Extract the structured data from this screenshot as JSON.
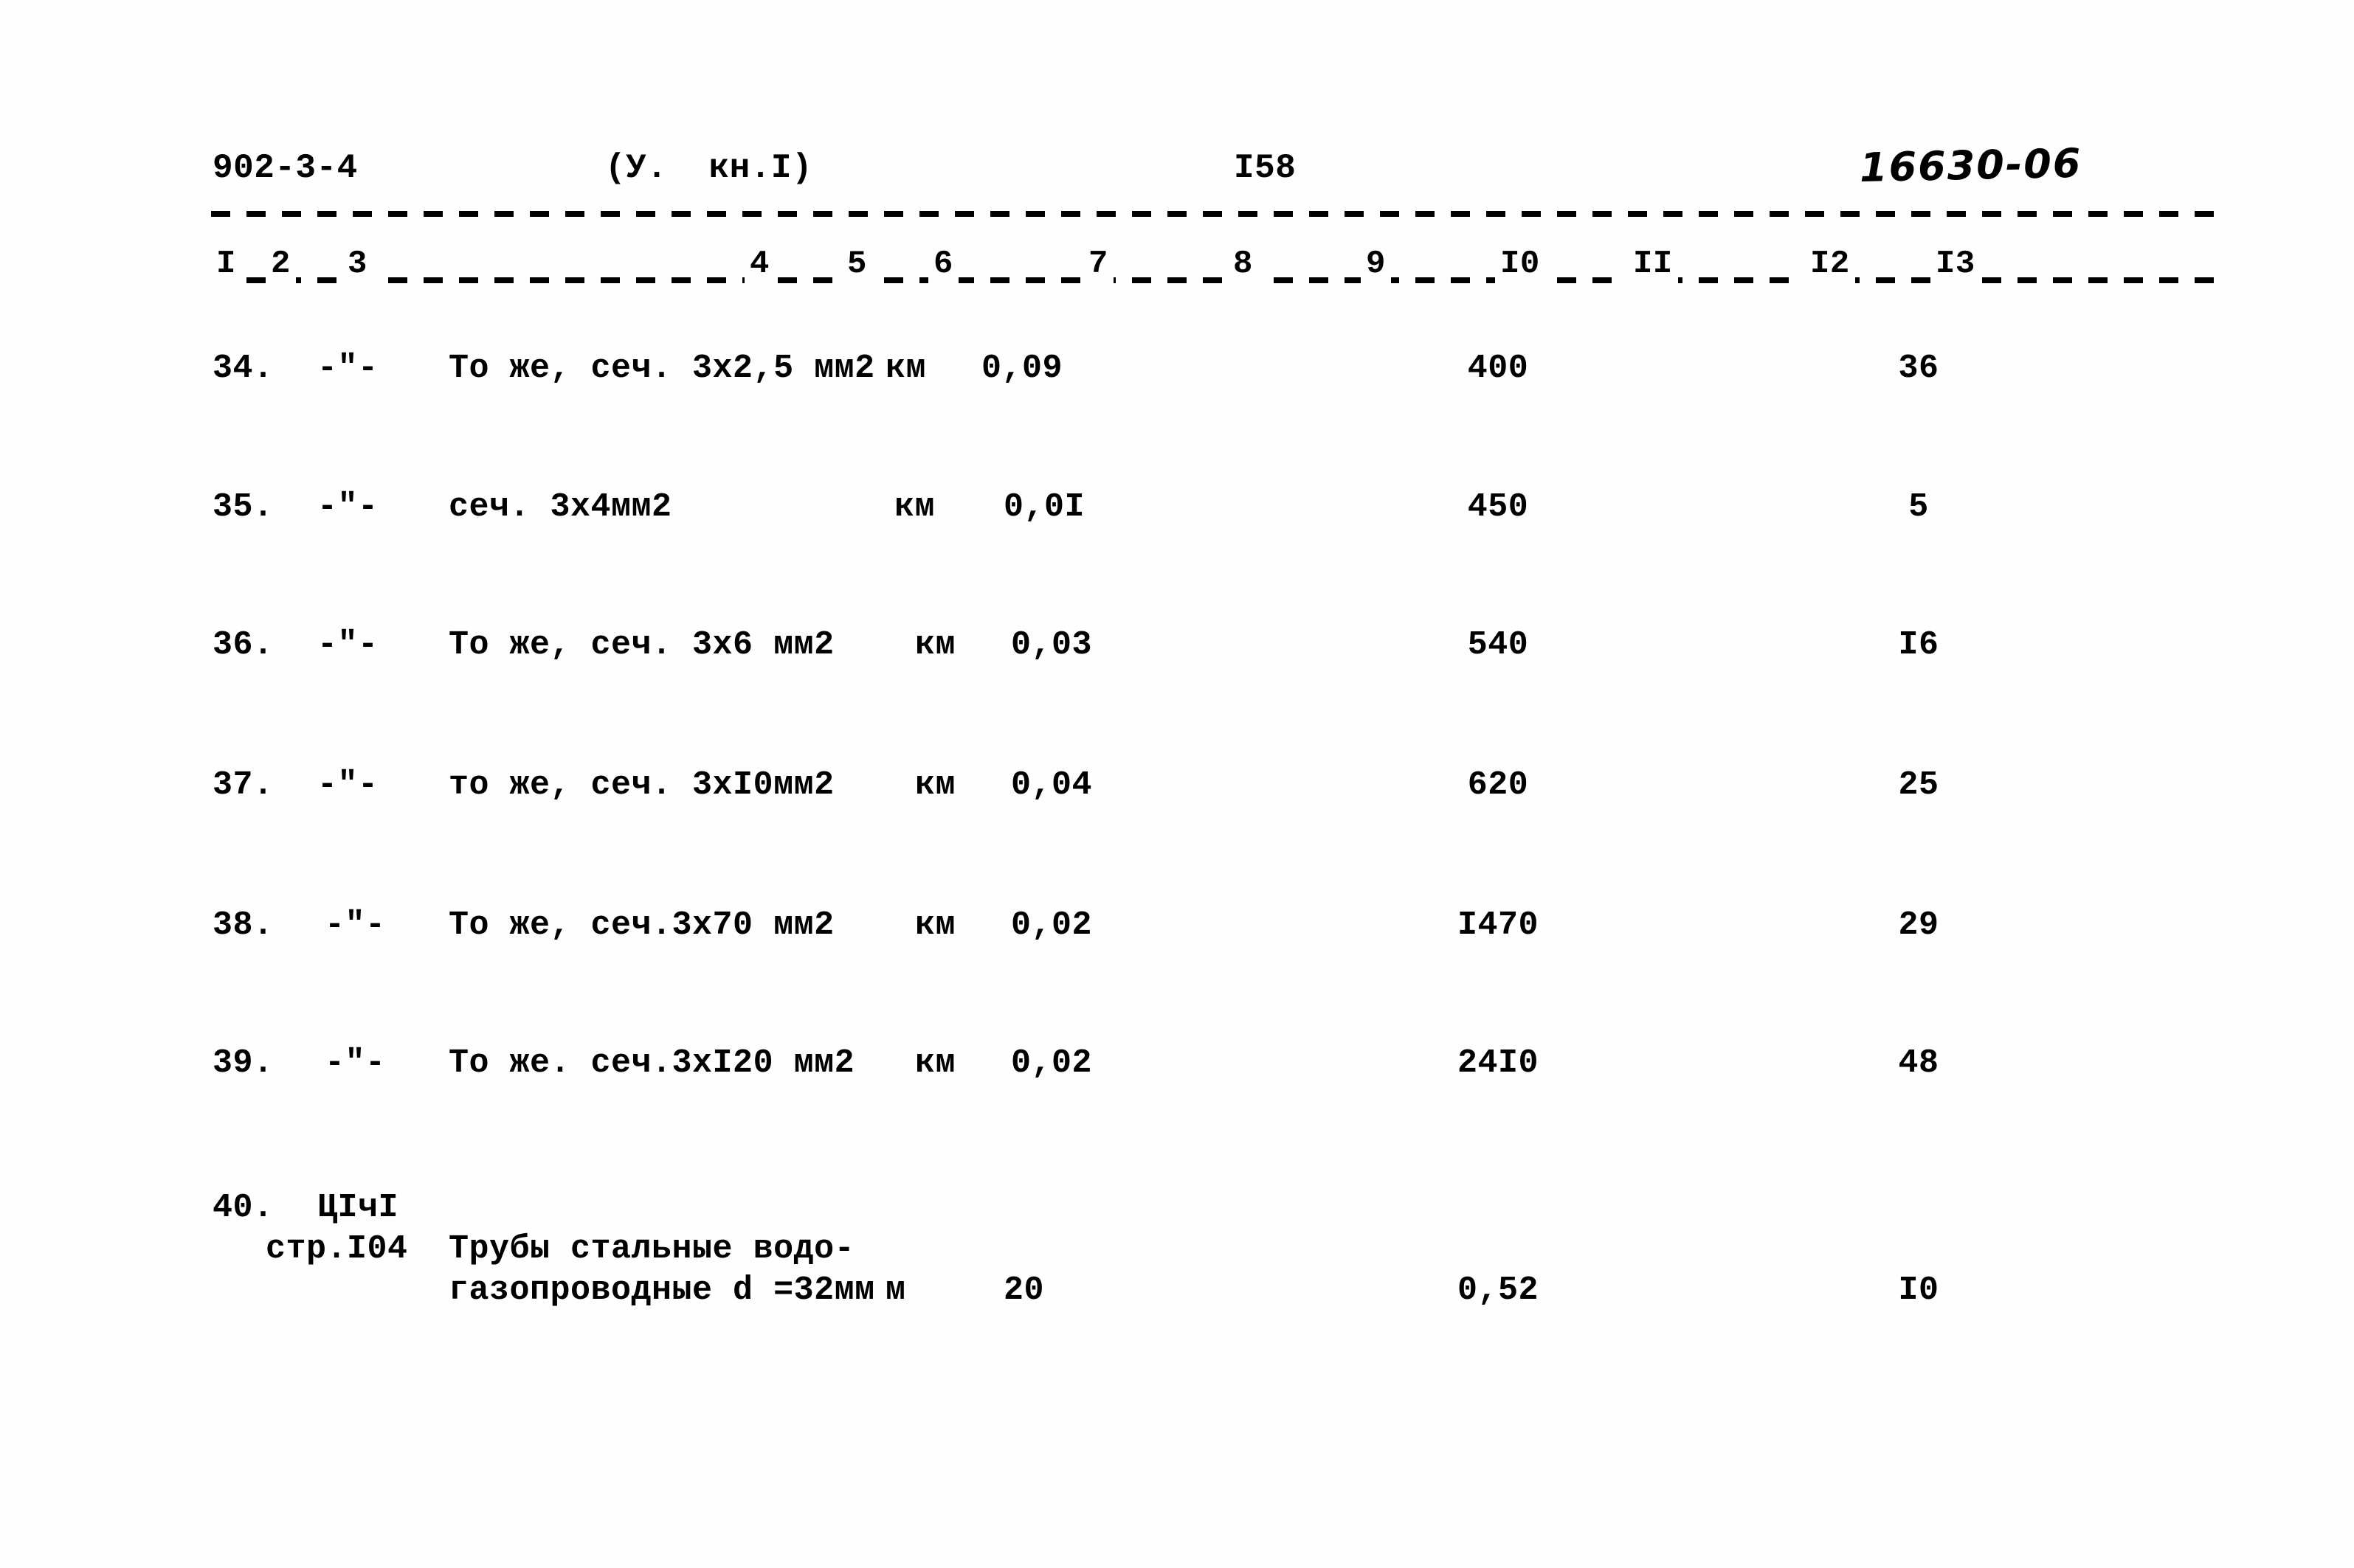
{
  "header": {
    "series_code": "902-3-4",
    "section_ref": "(У.  кн.I)",
    "page_number": "I58",
    "archive_stamp": "16630-06"
  },
  "table": {
    "column_numbers": [
      "I",
      "2",
      "3",
      "4",
      "5",
      "6",
      "7",
      "8",
      "9",
      "I0",
      "II",
      "I2",
      "I3"
    ],
    "rows": [
      {
        "num": "34.",
        "justification": "-\"-",
        "name": "То же, сеч. 3х2,5 мм2",
        "unit": "км",
        "qty": "0,09",
        "price": "400",
        "total": "36"
      },
      {
        "num": "35.",
        "justification": "-\"-",
        "name": "сеч. 3х4мм2",
        "unit": "км",
        "qty": "0,0I",
        "price": "450",
        "total": "5"
      },
      {
        "num": "36.",
        "justification": "-\"-",
        "name": "То же, сеч. 3х6 мм2",
        "unit": "км",
        "qty": "0,03",
        "price": "540",
        "total": "I6"
      },
      {
        "num": "37.",
        "justification": "-\"-",
        "name": "то же, сеч. 3хI0мм2",
        "unit": "км",
        "qty": "0,04",
        "price": "620",
        "total": "25"
      },
      {
        "num": "38.",
        "justification": "-\"-",
        "name": "То же, сеч.3х70 мм2",
        "unit": "км",
        "qty": "0,02",
        "price": "I470",
        "total": "29"
      },
      {
        "num": "39.",
        "justification": "-\"-",
        "name": "То же. сеч.3хI20 мм2",
        "unit": "км",
        "qty": "0,02",
        "price": "24I0",
        "total": "48"
      }
    ],
    "row_40": {
      "num": "40.",
      "justification_code": "ЦIчI",
      "page_ref": "стр.I04",
      "name_line1": "Трубы стальные водо-",
      "name_line2": "газопроводные d =32мм",
      "unit": "м",
      "qty": "20",
      "price": "0,52",
      "total": "I0"
    }
  }
}
